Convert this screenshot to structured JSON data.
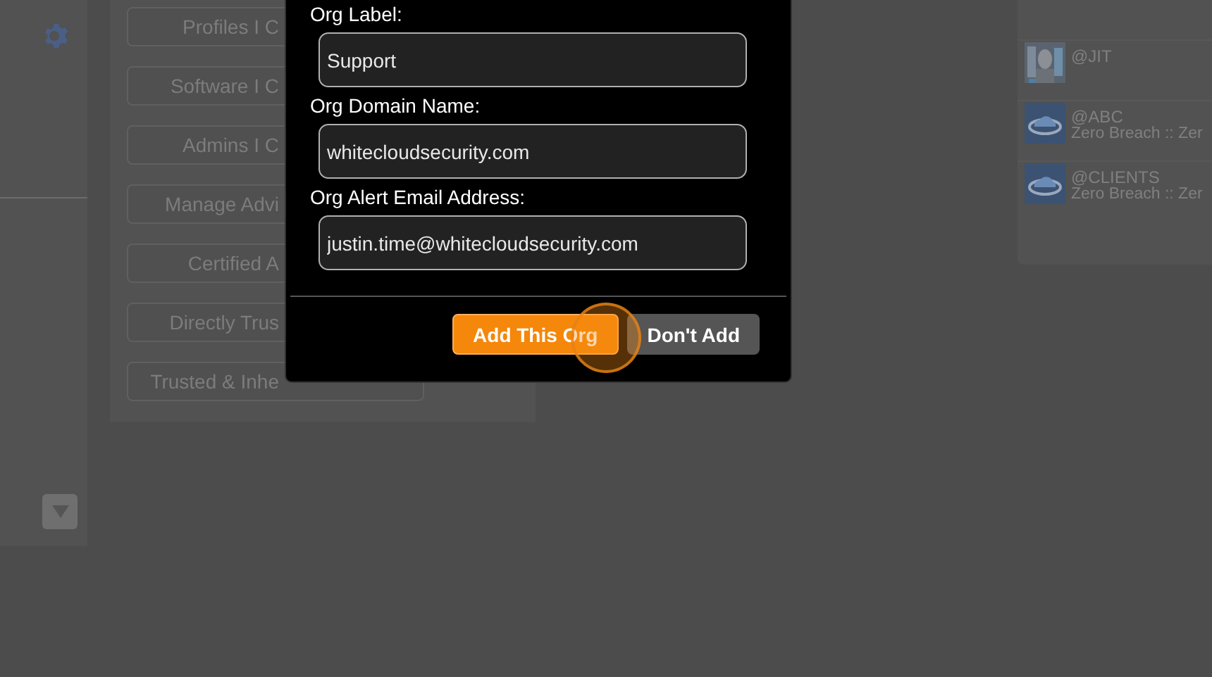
{
  "menu_buttons": [
    {
      "label": "Profiles I C"
    },
    {
      "label": "Software I C"
    },
    {
      "label": "Admins I C"
    },
    {
      "label": "Manage Advi"
    },
    {
      "label": "Certified A"
    },
    {
      "label": "Directly Trus"
    },
    {
      "label": "Trusted & Inhe"
    }
  ],
  "orgs": [
    {
      "handle": "@JIT",
      "kind": "picture"
    },
    {
      "handle": "@ABC",
      "subtitle": "Zero Breach :: Zer",
      "kind": "cloud"
    },
    {
      "handle": "@CLIENTS",
      "subtitle": "Zero Breach :: Zer",
      "kind": "cloud"
    }
  ],
  "dialog": {
    "fields": [
      {
        "label": "Org Label:",
        "value": "Support"
      },
      {
        "label": "Org Domain Name:",
        "value": "whitecloudsecurity.com"
      },
      {
        "label": "Org Alert Email Address:",
        "value": "justin.time@whitecloudsecurity.com"
      }
    ],
    "buttons": [
      {
        "label": "Add This Org",
        "kind": "primary"
      },
      {
        "label": "Don't Add",
        "kind": "secondary"
      }
    ]
  }
}
